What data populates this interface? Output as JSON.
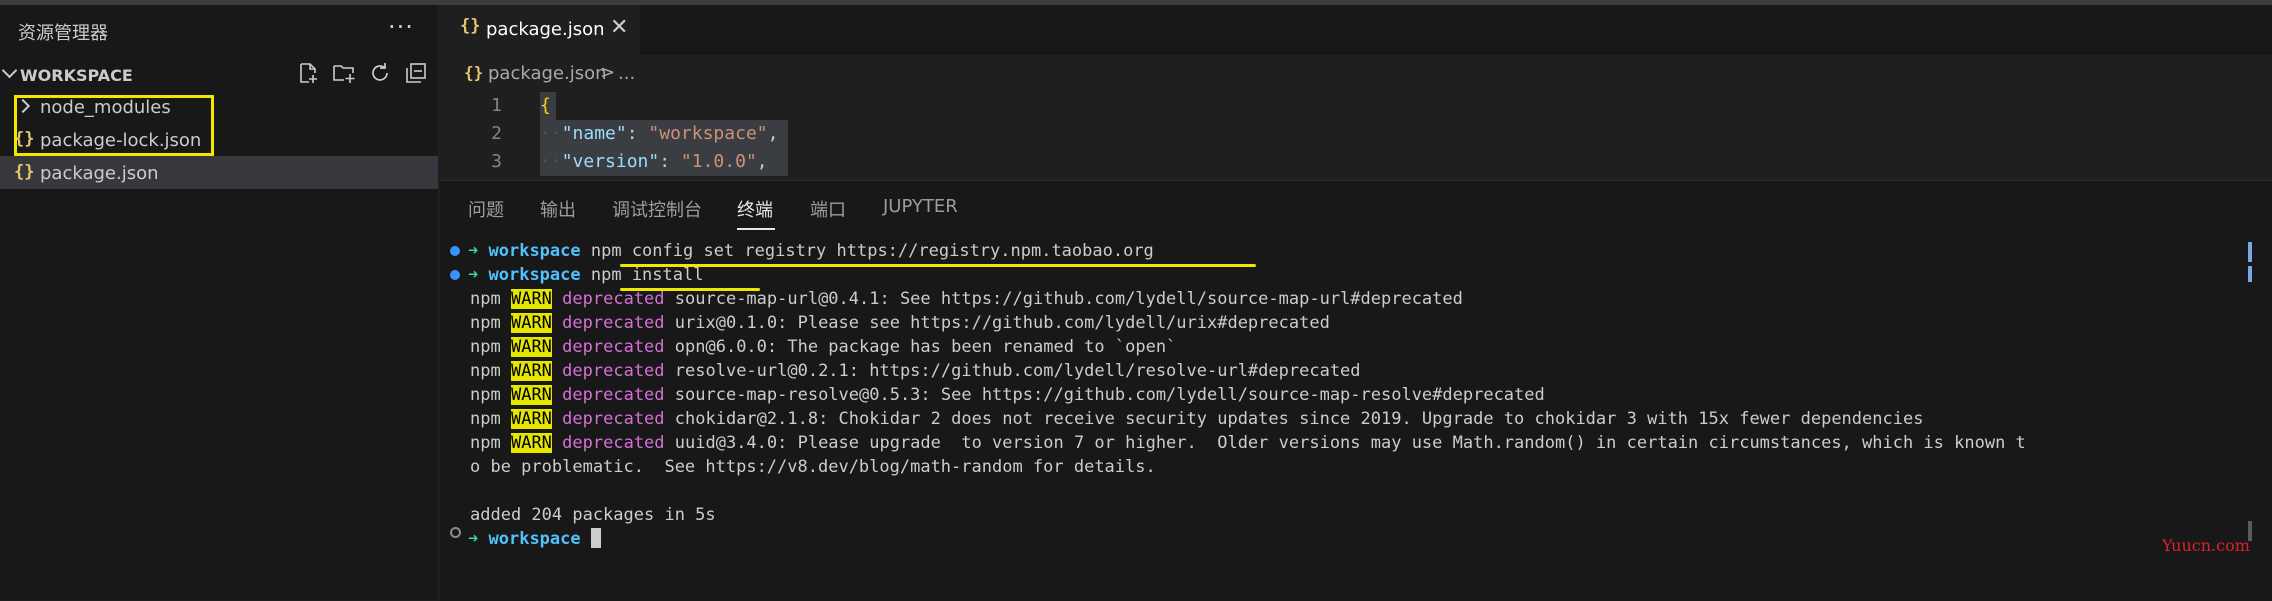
{
  "sidebar": {
    "title": "资源管理器",
    "more_label": "···",
    "workspace_label": "WORKSPACE",
    "toolbar": {
      "icons": [
        "new-file-icon",
        "new-folder-icon",
        "refresh-icon",
        "collapse-all-icon"
      ]
    },
    "items": [
      {
        "label": "node_modules",
        "kind": "folder"
      },
      {
        "label": "package-lock.json",
        "kind": "json",
        "icon": "{}"
      },
      {
        "label": "package.json",
        "kind": "json",
        "icon": "{}",
        "selected": true
      }
    ]
  },
  "editor": {
    "tab": {
      "icon": "{}",
      "label": "package.json",
      "close": "✕"
    },
    "breadcrumb": {
      "icon": "{}",
      "file": "package.json",
      "sep": ">",
      "more": "..."
    },
    "lines": [
      {
        "num": "1",
        "brace": "{"
      },
      {
        "num": "2",
        "key": "\"name\"",
        "value": "\"workspace\"",
        "tail": ","
      },
      {
        "num": "3",
        "key": "\"version\"",
        "value": "\"1.0.0\"",
        "tail": ","
      }
    ]
  },
  "panel": {
    "tabs": [
      "问题",
      "输出",
      "调试控制台",
      "终端",
      "端口",
      "JUPYTER"
    ],
    "active_tab": "终端"
  },
  "terminal": {
    "prompt_arrow": "➜",
    "prompt_dir": "workspace",
    "commands": [
      "npm config set registry https://registry.npm.taobao.org",
      "npm install"
    ],
    "warn_prefix": "npm",
    "warn_tag": "WARN",
    "warn_kind": "deprecated",
    "warnings": [
      "source-map-url@0.4.1: See https://github.com/lydell/source-map-url#deprecated",
      "urix@0.1.0: Please see https://github.com/lydell/urix#deprecated",
      "opn@6.0.0: The package has been renamed to `open`",
      "resolve-url@0.2.1: https://github.com/lydell/resolve-url#deprecated",
      "source-map-resolve@0.5.3: See https://github.com/lydell/source-map-resolve#deprecated",
      "chokidar@2.1.8: Chokidar 2 does not receive security updates since 2019. Upgrade to chokidar 3 with 15x fewer dependencies",
      "uuid@3.4.0: Please upgrade  to version 7 or higher.  Older versions may use Math.random() in certain circumstances, which is known t"
    ],
    "wrap_line": "o be problematic.  See https://v8.dev/blog/math-random for details.",
    "result": "added 204 packages in 5s"
  },
  "watermark": "Yuucn.com",
  "colors": {
    "highlight": "#f0e800",
    "warn_bg": "#e6e600",
    "prompt_arrow": "#3fd0a5",
    "prompt_dir": "#4fc1ff",
    "deprecated": "#d670d6"
  }
}
